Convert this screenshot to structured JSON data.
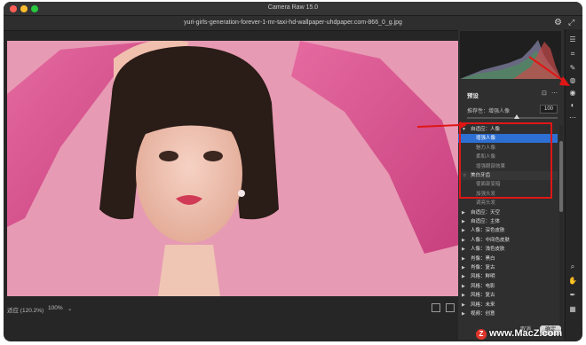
{
  "window": {
    "title": "Camera Raw 15.0"
  },
  "file": {
    "name": "yuri-girls-generation-forever-1-mr-taxi-hd-wallpaper-uhdpaper.com-866_0_g.jpg"
  },
  "footer": {
    "fit_label": "适应 (120.2%)",
    "zoom_value": "100%",
    "zoom_chevron": "⌄"
  },
  "presets": {
    "title": "预设",
    "amount_label": "推荐性：增强人像",
    "amount_value": "100",
    "amount_fraction": 0.55,
    "groups": [
      {
        "label": "自适应：人像",
        "expanded": true,
        "items": [
          {
            "label": "增强人像",
            "selected": true
          },
          {
            "label": "魅力人像",
            "selected": false
          },
          {
            "label": "柔和人像",
            "selected": false
          },
          {
            "label": "增强眼部效果",
            "selected": false
          }
        ]
      },
      {
        "label": "美白牙齿",
        "expanded": true,
        "star": "☆",
        "items": [
          {
            "label": "使面部变暗",
            "selected": false
          },
          {
            "label": "加强头发",
            "selected": false
          },
          {
            "label": "调亮头发",
            "selected": false
          }
        ]
      },
      {
        "label": "自适应：天空",
        "expanded": false
      },
      {
        "label": "自适应：主体",
        "expanded": false
      },
      {
        "label": "人像：深色皮肤",
        "expanded": false
      },
      {
        "label": "人像：中间色皮肤",
        "expanded": false
      },
      {
        "label": "人像：浅色皮肤",
        "expanded": false
      },
      {
        "label": "肖像：黑白",
        "expanded": false
      },
      {
        "label": "肖像：复古",
        "expanded": false
      },
      {
        "label": "风格：鲜明",
        "expanded": false
      },
      {
        "label": "风格：电影",
        "expanded": false
      },
      {
        "label": "风格：复古",
        "expanded": false
      },
      {
        "label": "风格：未来",
        "expanded": false
      },
      {
        "label": "视频：创意",
        "expanded": false
      }
    ]
  },
  "buttons": {
    "cancel": "取消",
    "ok": "确定"
  },
  "watermark": {
    "logo": "Z",
    "text": "www.MacZ.com"
  },
  "colors": {
    "accent": "#2e6fd3",
    "annotation": "#e01616",
    "background": "#e79ab3"
  }
}
